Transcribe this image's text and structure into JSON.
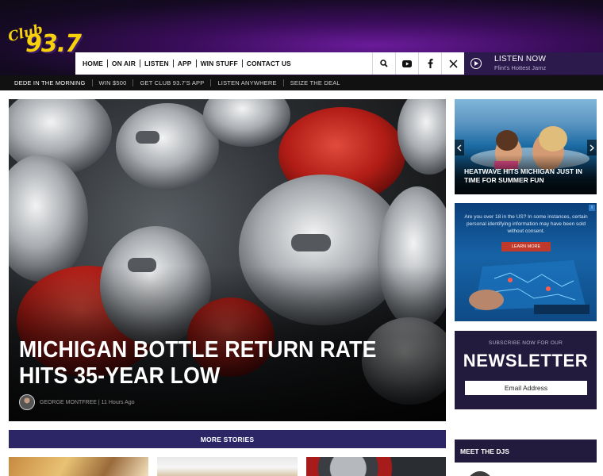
{
  "brand": {
    "logo_text": "Club 93.7",
    "logo_script": "Club",
    "logo_frequency": "93.7",
    "logo_color": "#f7d20a"
  },
  "nav": {
    "items": [
      {
        "label": "HOME"
      },
      {
        "label": "ON AIR"
      },
      {
        "label": "LISTEN"
      },
      {
        "label": "APP"
      },
      {
        "label": "WIN STUFF"
      },
      {
        "label": "CONTACT US"
      }
    ],
    "icons": [
      "search-icon",
      "youtube-icon",
      "facebook-icon",
      "x-icon"
    ]
  },
  "listen_now": {
    "title": "LISTEN NOW",
    "subtitle": "Flint's Hottest Jamz"
  },
  "subnav": {
    "items": [
      {
        "label": "DEDE IN THE MORNING"
      },
      {
        "label": "WIN $500"
      },
      {
        "label": "GET CLUB 93.7'S APP"
      },
      {
        "label": "LISTEN ANYWHERE"
      },
      {
        "label": "SEIZE THE DEAL"
      }
    ]
  },
  "hero": {
    "title": "MICHIGAN BOTTLE RETURN RATE HITS 35-YEAR LOW",
    "author": "GEORGE MONTFREE",
    "time": "11 Hours Ago",
    "byline": "GEORGE MONTFREE | 11 Hours Ago"
  },
  "more_stories": {
    "label": "MORE STORIES"
  },
  "side_feature": {
    "title": "HEATWAVE HITS MICHIGAN JUST IN TIME FOR SUMMER FUN"
  },
  "ad": {
    "text": "Are you over 18 in the US? In some instances, certain personal identifying information may have been sold without consent.",
    "button": "LEARN MORE"
  },
  "newsletter": {
    "subtitle": "SUBSCRIBE NOW FOR OUR",
    "title": "NEWSLETTER",
    "placeholder": "Email Address"
  },
  "meet_djs": {
    "label": "MEET THE DJS"
  },
  "colors": {
    "nav_dark": "#2c1a4d",
    "more_stories_bg": "#2c2666",
    "panel_bg": "#231b3d",
    "accent_purple": "#6a1b9a"
  }
}
